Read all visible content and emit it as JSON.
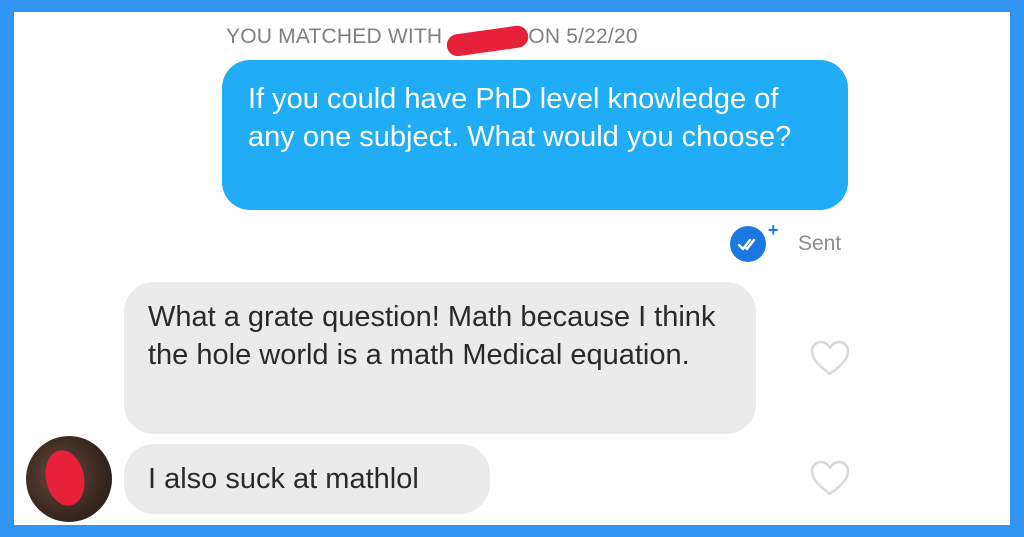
{
  "header": {
    "match_prefix": "YOU MATCHED WITH",
    "match_suffix": "ON 5/22/20"
  },
  "messages": {
    "sent": {
      "text": "If you could have PhD level knowledge of any one subject. What would you choose?",
      "status": "Sent"
    },
    "received": [
      {
        "text": "What a grate question! Math because I think the hole world is a math Medical equation."
      },
      {
        "text": "I also suck at mathlol"
      }
    ]
  },
  "icons": {
    "read_receipt": "double-check-icon",
    "like": "heart-outline-icon"
  },
  "colors": {
    "border": "#2f95f0",
    "sent_bubble": "#20adf5",
    "received_bubble": "#ebebeb",
    "redaction": "#e8213a",
    "receipt_badge": "#1a78e0"
  }
}
